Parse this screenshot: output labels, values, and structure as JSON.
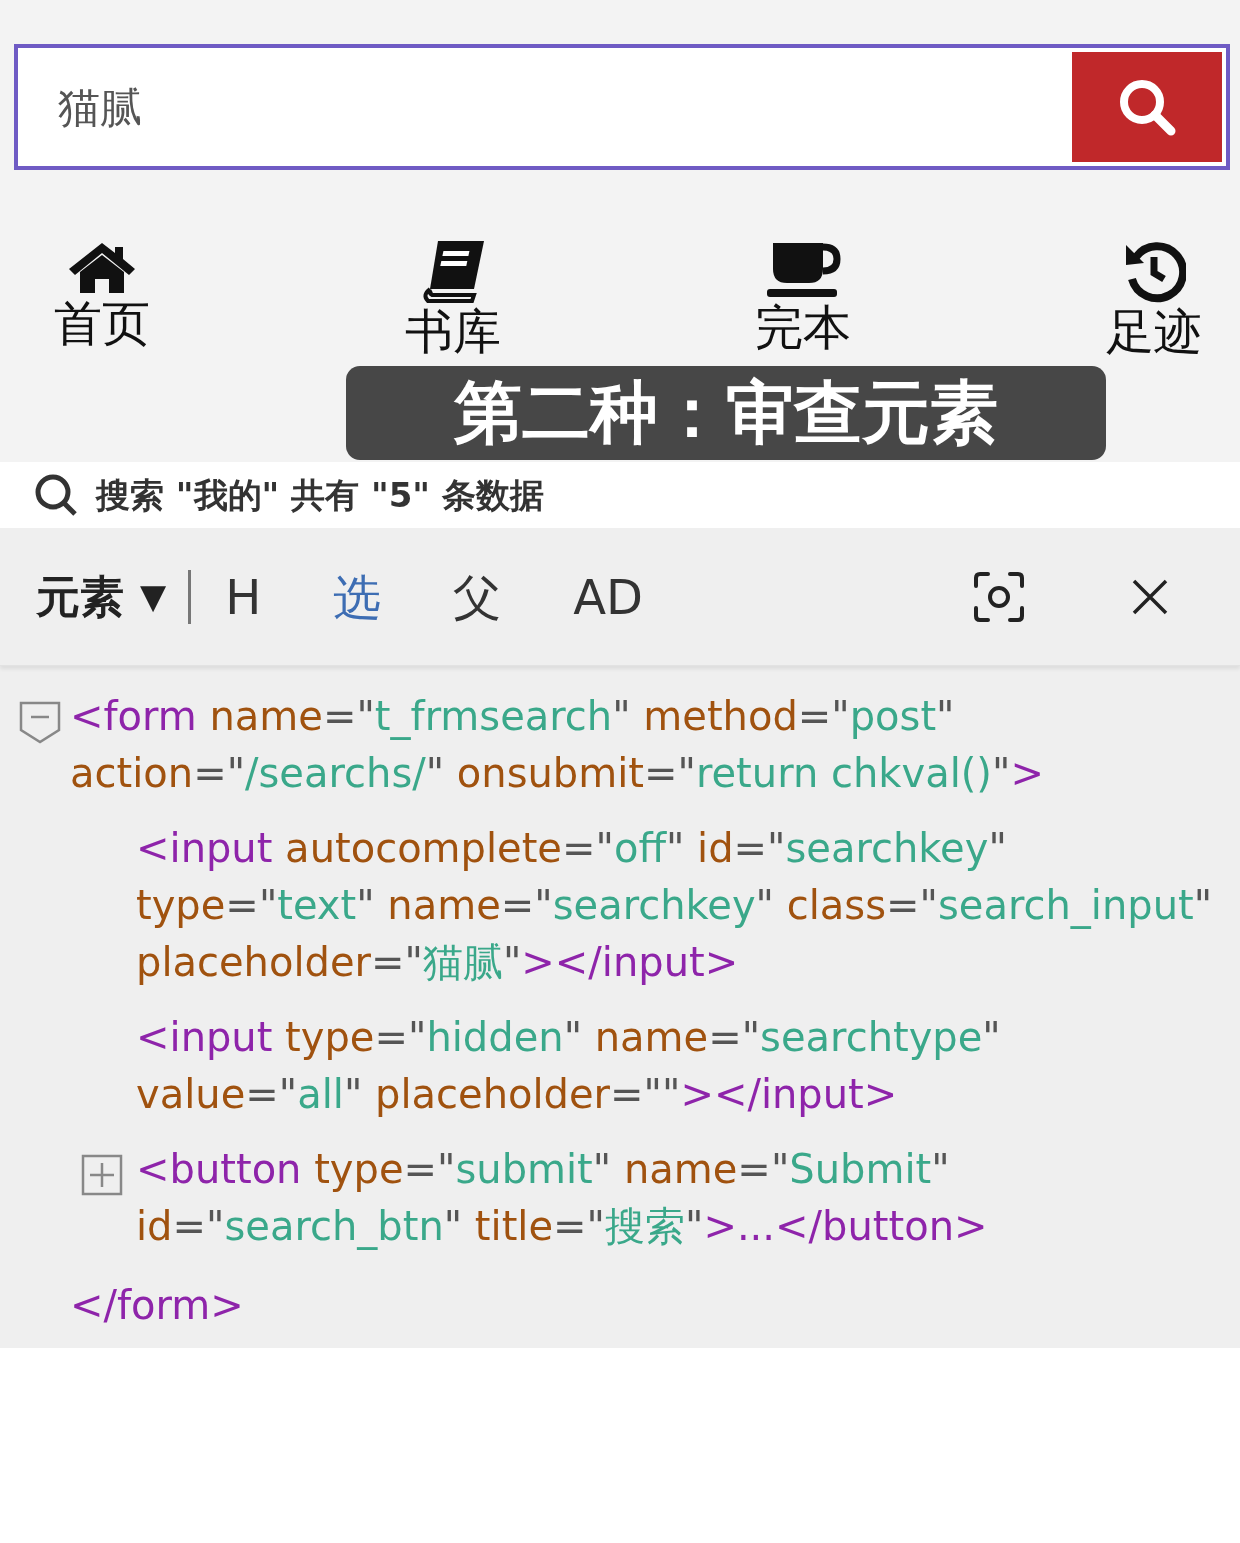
{
  "search": {
    "placeholder": "猫腻",
    "focused": true
  },
  "nav": [
    {
      "label": "首页"
    },
    {
      "label": "书库"
    },
    {
      "label": "完本"
    },
    {
      "label": "足迹"
    }
  ],
  "caption": "第二种：审查元素",
  "result_line": "搜索 \"我的\" 共有 \"5\" 条数据",
  "devtools": {
    "mode": "元素",
    "dropdown": "▼",
    "tabs": [
      {
        "label": "H",
        "selected": false
      },
      {
        "label": "选",
        "selected": true
      },
      {
        "label": "父",
        "selected": false
      },
      {
        "label": "AD",
        "selected": false
      }
    ],
    "tree": {
      "expanded": true,
      "open": [
        {
          "kind": "tag",
          "text": "<form"
        },
        {
          "kind": "attr",
          "text": " name"
        },
        {
          "kind": "punct",
          "text": "=\""
        },
        {
          "kind": "value",
          "text": "t_frmsearch"
        },
        {
          "kind": "punct",
          "text": "\""
        },
        {
          "kind": "attr",
          "text": " method"
        },
        {
          "kind": "punct",
          "text": "=\""
        },
        {
          "kind": "value",
          "text": "post"
        },
        {
          "kind": "punct",
          "text": "\""
        },
        {
          "kind": "attr",
          "text": " action"
        },
        {
          "kind": "punct",
          "text": "=\""
        },
        {
          "kind": "value",
          "text": "/searchs/"
        },
        {
          "kind": "punct",
          "text": "\""
        },
        {
          "kind": "attr",
          "text": " onsubmit"
        },
        {
          "kind": "punct",
          "text": "=\""
        },
        {
          "kind": "value",
          "text": "return chkval()"
        },
        {
          "kind": "punct",
          "text": "\""
        },
        {
          "kind": "tag",
          "text": ">"
        }
      ],
      "children": [
        {
          "kind": "leaf",
          "tokens": [
            {
              "kind": "tag",
              "text": "<input"
            },
            {
              "kind": "attr",
              "text": " autocomplete"
            },
            {
              "kind": "punct",
              "text": "=\""
            },
            {
              "kind": "value",
              "text": "off"
            },
            {
              "kind": "punct",
              "text": "\""
            },
            {
              "kind": "attr",
              "text": " id"
            },
            {
              "kind": "punct",
              "text": "=\""
            },
            {
              "kind": "value",
              "text": "searchkey"
            },
            {
              "kind": "punct",
              "text": "\""
            },
            {
              "kind": "attr",
              "text": " type"
            },
            {
              "kind": "punct",
              "text": "=\""
            },
            {
              "kind": "value",
              "text": "text"
            },
            {
              "kind": "punct",
              "text": "\""
            },
            {
              "kind": "attr",
              "text": " name"
            },
            {
              "kind": "punct",
              "text": "=\""
            },
            {
              "kind": "value",
              "text": "searchkey"
            },
            {
              "kind": "punct",
              "text": "\""
            },
            {
              "kind": "attr",
              "text": " class"
            },
            {
              "kind": "punct",
              "text": "=\""
            },
            {
              "kind": "value",
              "text": "search_input"
            },
            {
              "kind": "punct",
              "text": "\""
            },
            {
              "kind": "attr",
              "text": " placeholder"
            },
            {
              "kind": "punct",
              "text": "=\""
            },
            {
              "kind": "value",
              "text": "猫腻"
            },
            {
              "kind": "punct",
              "text": "\""
            },
            {
              "kind": "tag",
              "text": "></input>"
            }
          ]
        },
        {
          "kind": "leaf",
          "tokens": [
            {
              "kind": "tag",
              "text": "<input"
            },
            {
              "kind": "attr",
              "text": " type"
            },
            {
              "kind": "punct",
              "text": "=\""
            },
            {
              "kind": "value",
              "text": "hidden"
            },
            {
              "kind": "punct",
              "text": "\""
            },
            {
              "kind": "attr",
              "text": " name"
            },
            {
              "kind": "punct",
              "text": "=\""
            },
            {
              "kind": "value",
              "text": "searchtype"
            },
            {
              "kind": "punct",
              "text": "\""
            },
            {
              "kind": "attr",
              "text": " value"
            },
            {
              "kind": "punct",
              "text": "=\""
            },
            {
              "kind": "value",
              "text": "all"
            },
            {
              "kind": "punct",
              "text": "\""
            },
            {
              "kind": "attr",
              "text": " placeholder"
            },
            {
              "kind": "punct",
              "text": "=\"\""
            },
            {
              "kind": "tag",
              "text": "></input>"
            }
          ]
        },
        {
          "kind": "folder",
          "expanded": false,
          "tokens": [
            {
              "kind": "tag",
              "text": "<button"
            },
            {
              "kind": "attr",
              "text": " type"
            },
            {
              "kind": "punct",
              "text": "=\""
            },
            {
              "kind": "value",
              "text": "submit"
            },
            {
              "kind": "punct",
              "text": "\""
            },
            {
              "kind": "attr",
              "text": " name"
            },
            {
              "kind": "punct",
              "text": "=\""
            },
            {
              "kind": "value",
              "text": "Submit"
            },
            {
              "kind": "punct",
              "text": "\""
            },
            {
              "kind": "attr",
              "text": " id"
            },
            {
              "kind": "punct",
              "text": "=\""
            },
            {
              "kind": "value",
              "text": "search_btn"
            },
            {
              "kind": "punct",
              "text": "\""
            },
            {
              "kind": "attr",
              "text": " title"
            },
            {
              "kind": "punct",
              "text": "=\""
            },
            {
              "kind": "value",
              "text": "搜索"
            },
            {
              "kind": "punct",
              "text": "\""
            },
            {
              "kind": "tag",
              "text": ">...</button>"
            }
          ]
        }
      ],
      "close": [
        {
          "kind": "tag",
          "text": "</form>"
        }
      ]
    }
  }
}
